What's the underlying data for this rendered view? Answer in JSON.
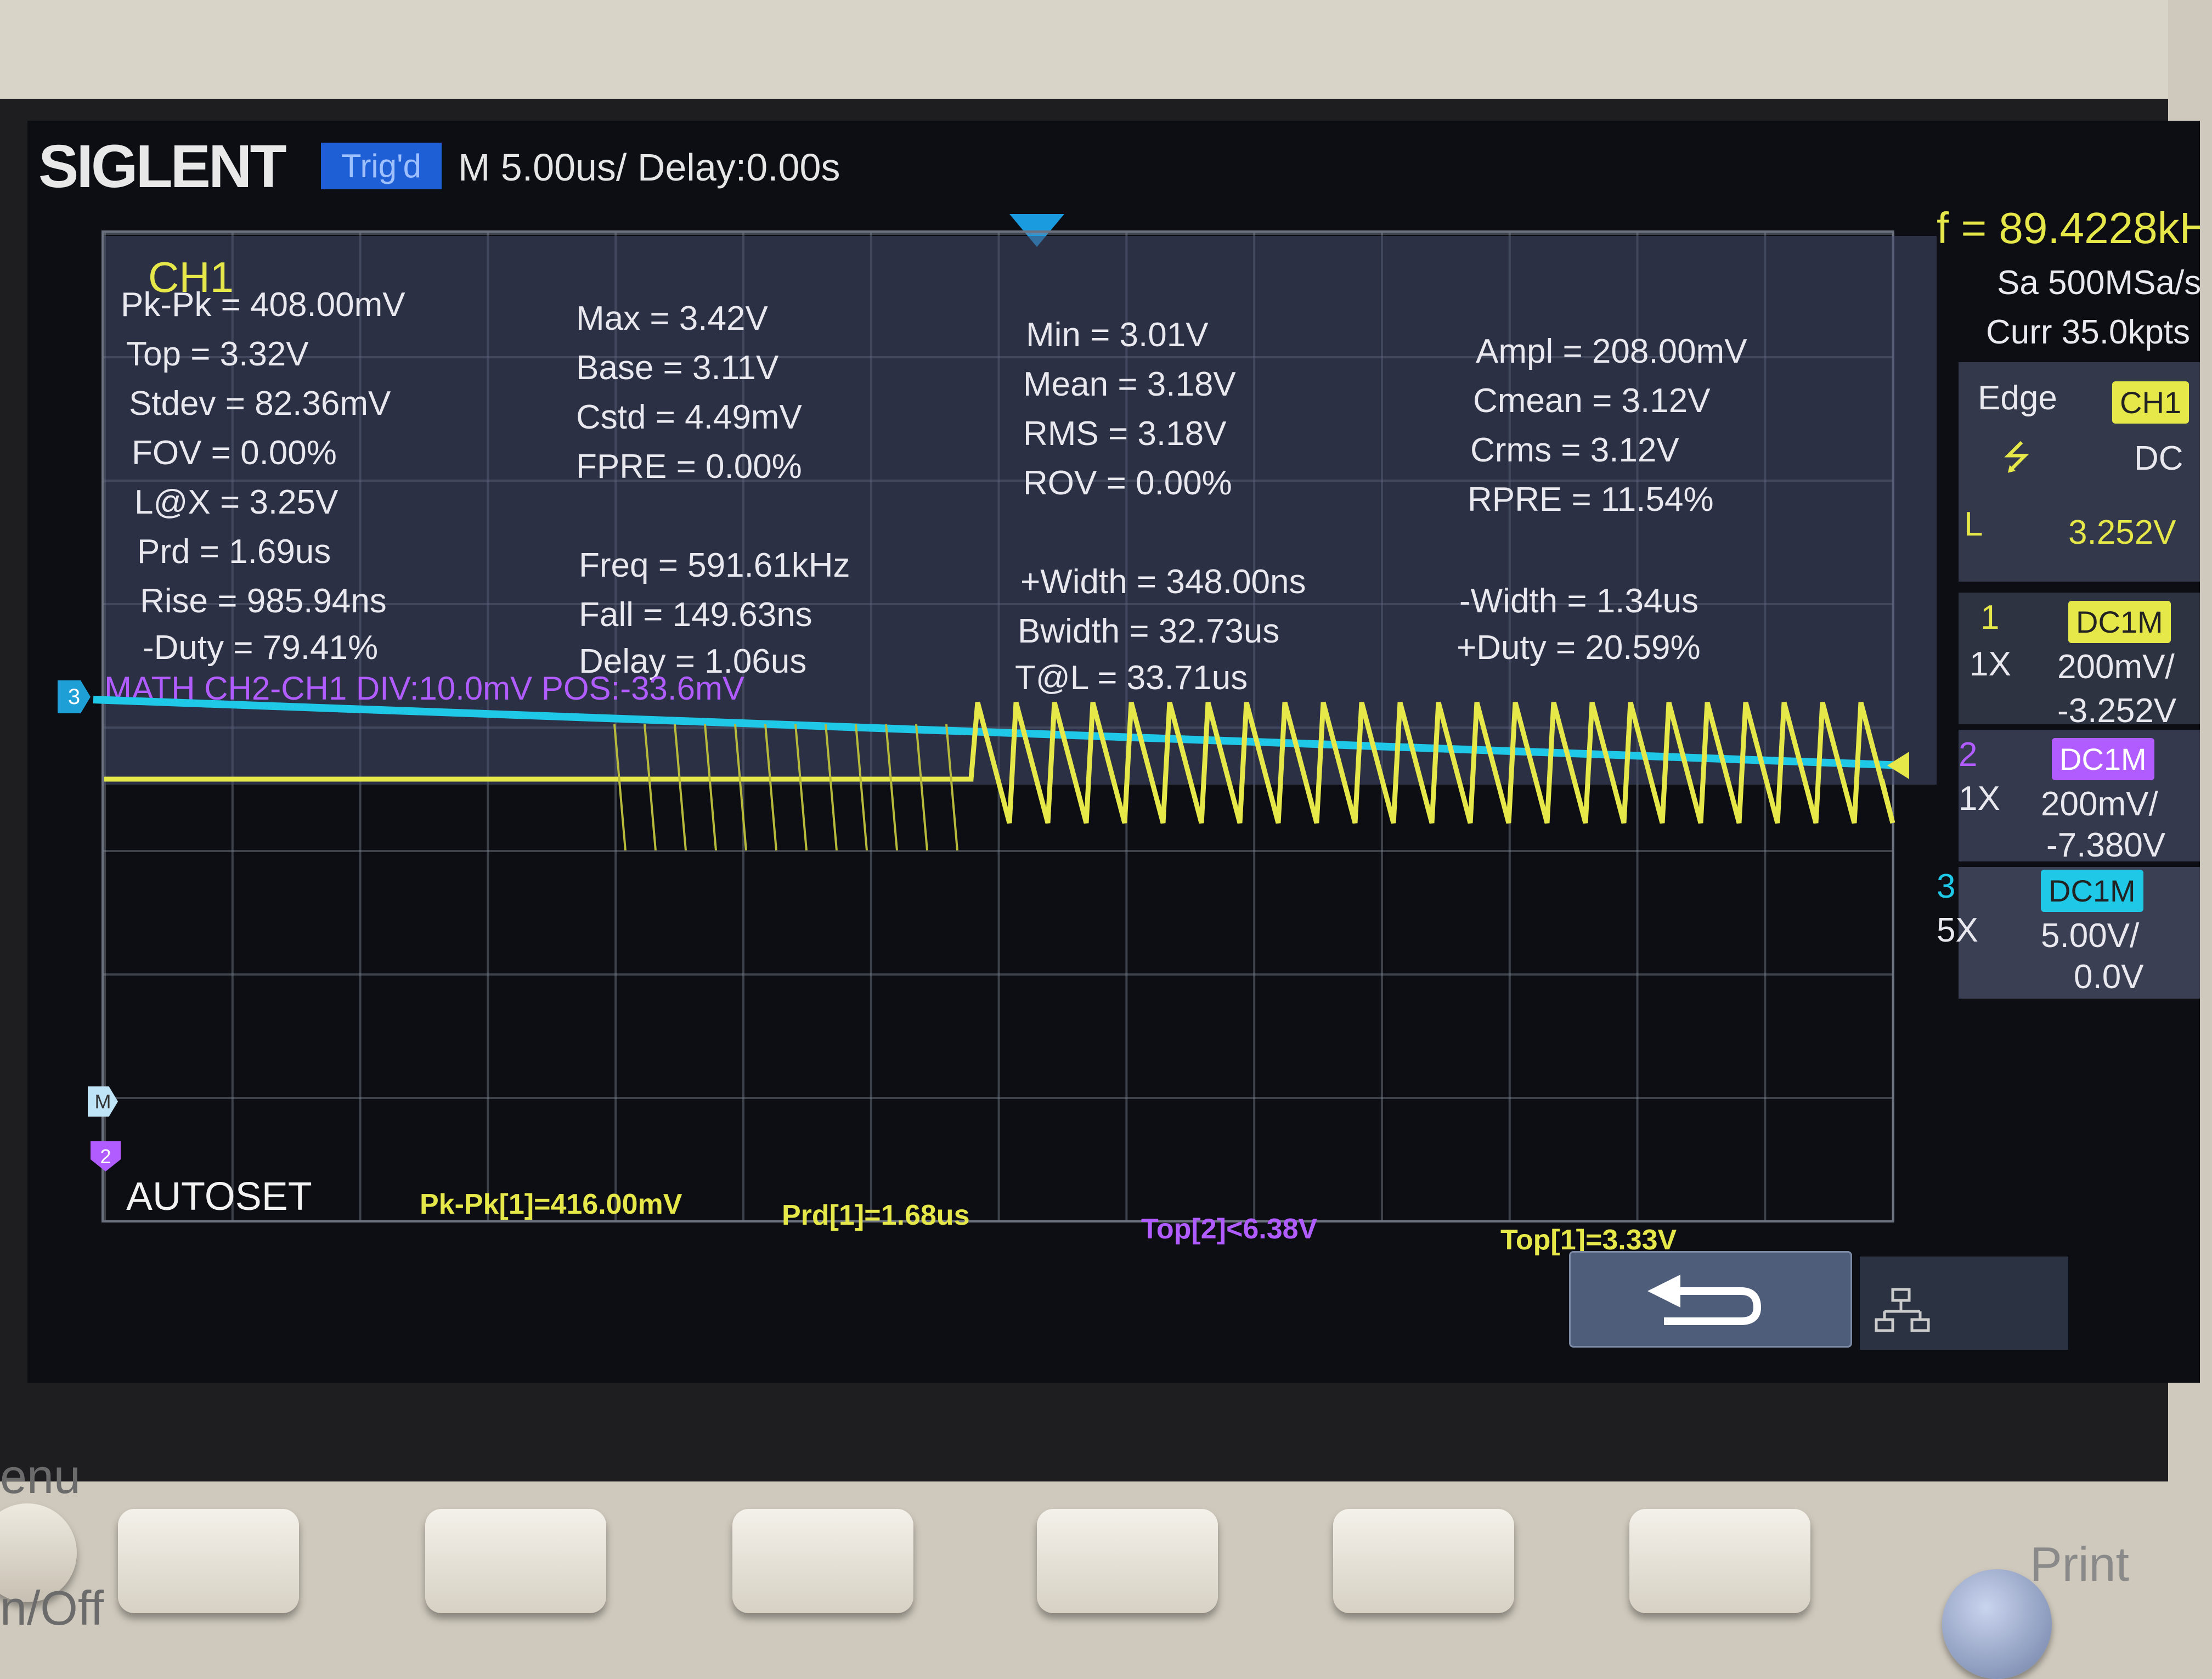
{
  "header": {
    "brand": "SIGLENT",
    "trigger_status": "Trig'd",
    "timebase": "M 5.00us/  Delay:0.00s"
  },
  "measurements": {
    "channel": "CH1",
    "col1": [
      "Pk-Pk = 408.00mV",
      "Top = 3.32V",
      "Stdev = 82.36mV",
      "FOV = 0.00%",
      "L@X = 3.25V",
      "Prd = 1.69us",
      "Rise = 985.94ns",
      "-Duty = 79.41%"
    ],
    "col2": [
      "Max = 3.42V",
      "Base = 3.11V",
      "Cstd = 4.49mV",
      "FPRE = 0.00%",
      "Freq = 591.61kHz",
      "Fall = 149.63ns",
      "Delay = 1.06us"
    ],
    "col3": [
      "Min = 3.01V",
      "Mean = 3.18V",
      "RMS = 3.18V",
      "ROV = 0.00%",
      "+Width = 348.00ns",
      "Bwidth = 32.73us",
      "T@L = 33.71us"
    ],
    "col4": [
      "Ampl = 208.00mV",
      "Cmean = 3.12V",
      "Crms = 3.12V",
      "RPRE = 11.54%",
      "-Width = 1.34us",
      "+Duty = 20.59%"
    ]
  },
  "math_label": "MATH  CH2-CH1  DIV:10.0mV  POS:-33.6mV",
  "markers": {
    "ch3": "3",
    "math": "M",
    "ch2": "2"
  },
  "footer": {
    "autoset": "AUTOSET",
    "pkpk1": "Pk-Pk[1]=416.00mV",
    "prd1": "Prd[1]=1.68us",
    "top2": "Top[2]<6.38V",
    "top1": "Top[1]=3.33V"
  },
  "right_panel": {
    "freq": "f = 89.4228kH",
    "sample_rate": "Sa 500MSa/s",
    "curr": "Curr 35.0kpts",
    "trigger_type": "Edge",
    "trigger_source": "CH1",
    "slope_symbol": "⭍",
    "coupling": "DC",
    "level_label": "L",
    "level_value": "3.252V",
    "ch1": {
      "num": "1",
      "coupling": "DC1M",
      "probe": "1X",
      "scale": "200mV/",
      "offset": "-3.252V"
    },
    "ch2": {
      "num": "2",
      "coupling": "DC1M",
      "probe": "1X",
      "scale": "200mV/",
      "offset": "-7.380V"
    },
    "ch3": {
      "num": "3",
      "coupling": "DC1M",
      "probe": "5X",
      "scale": "5.00V/",
      "offset": "0.0V"
    }
  },
  "colors": {
    "ch1": "#e6e84a",
    "ch2": "#b05cff",
    "ch3": "#1ec8e6",
    "accent": "#1f5fd6"
  },
  "bottom_labels": {
    "menu": "enu",
    "onoff": "n/Off",
    "print": "Print"
  },
  "icons": {
    "back": "return-arrow-icon",
    "network": "network-icon"
  }
}
